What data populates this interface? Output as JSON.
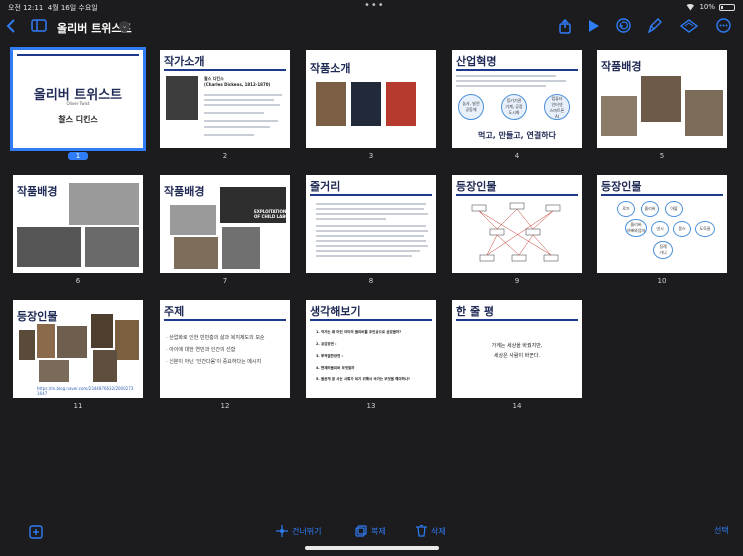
{
  "status": {
    "time": "오전 12:11",
    "date": "4월 16일 수요일",
    "battery": "10%"
  },
  "toolbar": {
    "doc_title": "올리버 트위스트"
  },
  "slides": [
    {
      "num": "1",
      "title": "올리버 트위스트",
      "subtitle": "Oliver Twist",
      "author": "찰스 디킨스"
    },
    {
      "num": "2",
      "title": "작가소개",
      "name": "찰스 디킨스",
      "name_en": "(Charles Dickens, 1812-1870)"
    },
    {
      "num": "3",
      "title": "작품소개"
    },
    {
      "num": "4",
      "title": "산업혁명",
      "tagline": "먹고, 만들고, 연결하다",
      "c1": "농사, 발전\n공동체",
      "c2": "증기기관\n기계, 공장\n도시화",
      "c3": "컴퓨터\n인터넷\n스마트폰\nAI"
    },
    {
      "num": "5",
      "title": "작품배경"
    },
    {
      "num": "6",
      "title": "작품배경"
    },
    {
      "num": "7",
      "title": "작품배경",
      "caption": "EXPLOITATION\nOF CHILD LABOUR"
    },
    {
      "num": "8",
      "title": "줄거리"
    },
    {
      "num": "9",
      "title": "등장인물"
    },
    {
      "num": "10",
      "title": "등장인물",
      "names": [
        "로즈",
        "올리버",
        "아불",
        "올리버\n아빠와엄마",
        "낸시",
        "몽스",
        "도둑들",
        "정례\n가니"
      ]
    },
    {
      "num": "11",
      "title": "등장인물",
      "url": "https://m.blog.naver.com/2344876632/2000273 1647"
    },
    {
      "num": "12",
      "title": "주제",
      "bullets": [
        "산업화로 인한 빈민층의 삶과 복지제도의 모순",
        "아이에 대한 연민과 인간의 선함",
        "신분이 아닌 '인간다움'이 중요하다는 메시지"
      ]
    },
    {
      "num": "13",
      "title": "생각해보기",
      "items": [
        "1. 작가는 왜 어린 아이의 올리버를 주인공으로 삼았을까?",
        "2. 공감장면 :",
        "3. 부적절한장면 :",
        "4. 현재의올리버 무엇일까",
        "5. 올곧게 잘 사는 사회가 되기 위해서 국가는 무엇을 해야하나?"
      ]
    },
    {
      "num": "14",
      "title": "한 줄 평",
      "line1": "가계는 세상을 바꿨지만,",
      "line2": "세상은 사람이 바꾼다."
    }
  ],
  "bottom": {
    "skip_label": "건너뛰기",
    "copy_label": "복제",
    "delete_label": "삭제",
    "select_label": "선택"
  }
}
